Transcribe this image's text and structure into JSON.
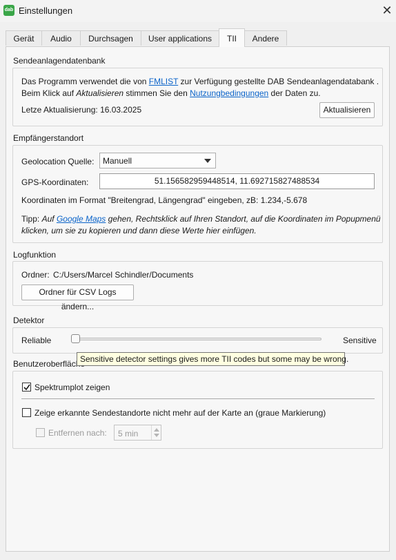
{
  "window": {
    "title": "Einstellungen",
    "app_icon_text": "dab",
    "close_glyph": "✕"
  },
  "tabs": [
    {
      "label": "Gerät"
    },
    {
      "label": "Audio"
    },
    {
      "label": "Durchsagen"
    },
    {
      "label": "User applications"
    },
    {
      "label": "TII",
      "active": true
    },
    {
      "label": "Andere"
    }
  ],
  "database": {
    "title": "Sendeanlagendatenbank",
    "line1_pre": "Das Programm verwendet die von ",
    "line1_link": "FMLIST",
    "line1_post": " zur Verfügung gestellte DAB Sendeanlagendatabank .",
    "line2_pre": "Beim Klick auf ",
    "line2_italic": "Aktualisieren",
    "line2_mid": " stimmen Sie den ",
    "line2_link": "Nutzungbedingungen",
    "line2_post": " der Daten zu.",
    "last_update_label": "Letze Aktualisierung: 16.03.2025",
    "update_button": "Aktualisieren"
  },
  "location": {
    "title": "Empfängerstandort",
    "source_label": "Geolocation Quelle:",
    "source_value": "Manuell",
    "gps_label": "GPS-Koordinaten:",
    "gps_value": "51.156582959448514, 11.692715827488534",
    "format_hint": "Koordinaten im Format \"Breitengrad, Längengrad\" eingeben, zB: 1.234,-5.678",
    "tip_pre": "Tipp: ",
    "tip_italic1": "Auf ",
    "tip_link": "Google Maps",
    "tip_italic2": " gehen, Rechtsklick auf Ihren Standort, auf die Koordinaten im Popupmenü",
    "tip_line2": "klicken, um sie zu kopieren und dann diese Werte hier einfügen."
  },
  "log": {
    "title": "Logfunktion",
    "folder_label": "Ordner:",
    "folder_value": "C:/Users/Marcel Schindler/Documents",
    "change_button": "Ordner für CSV Logs ändern..."
  },
  "detector": {
    "title": "Detektor",
    "left_label": "Reliable",
    "right_label": "Sensitive",
    "slider_value": 0,
    "tooltip": "Sensitive detector settings gives more TII codes but some may be wrong."
  },
  "ui": {
    "title": "Benutzeroberfläche",
    "spectrum_label": "Spektrumplot zeigen",
    "spectrum_checked": true,
    "hide_label": "Zeige erkannte Sendestandorte nicht mehr auf der Karte an (graue Markierung)",
    "hide_checked": false,
    "remove_label": "Entfernen nach:",
    "remove_value": "5 min"
  }
}
